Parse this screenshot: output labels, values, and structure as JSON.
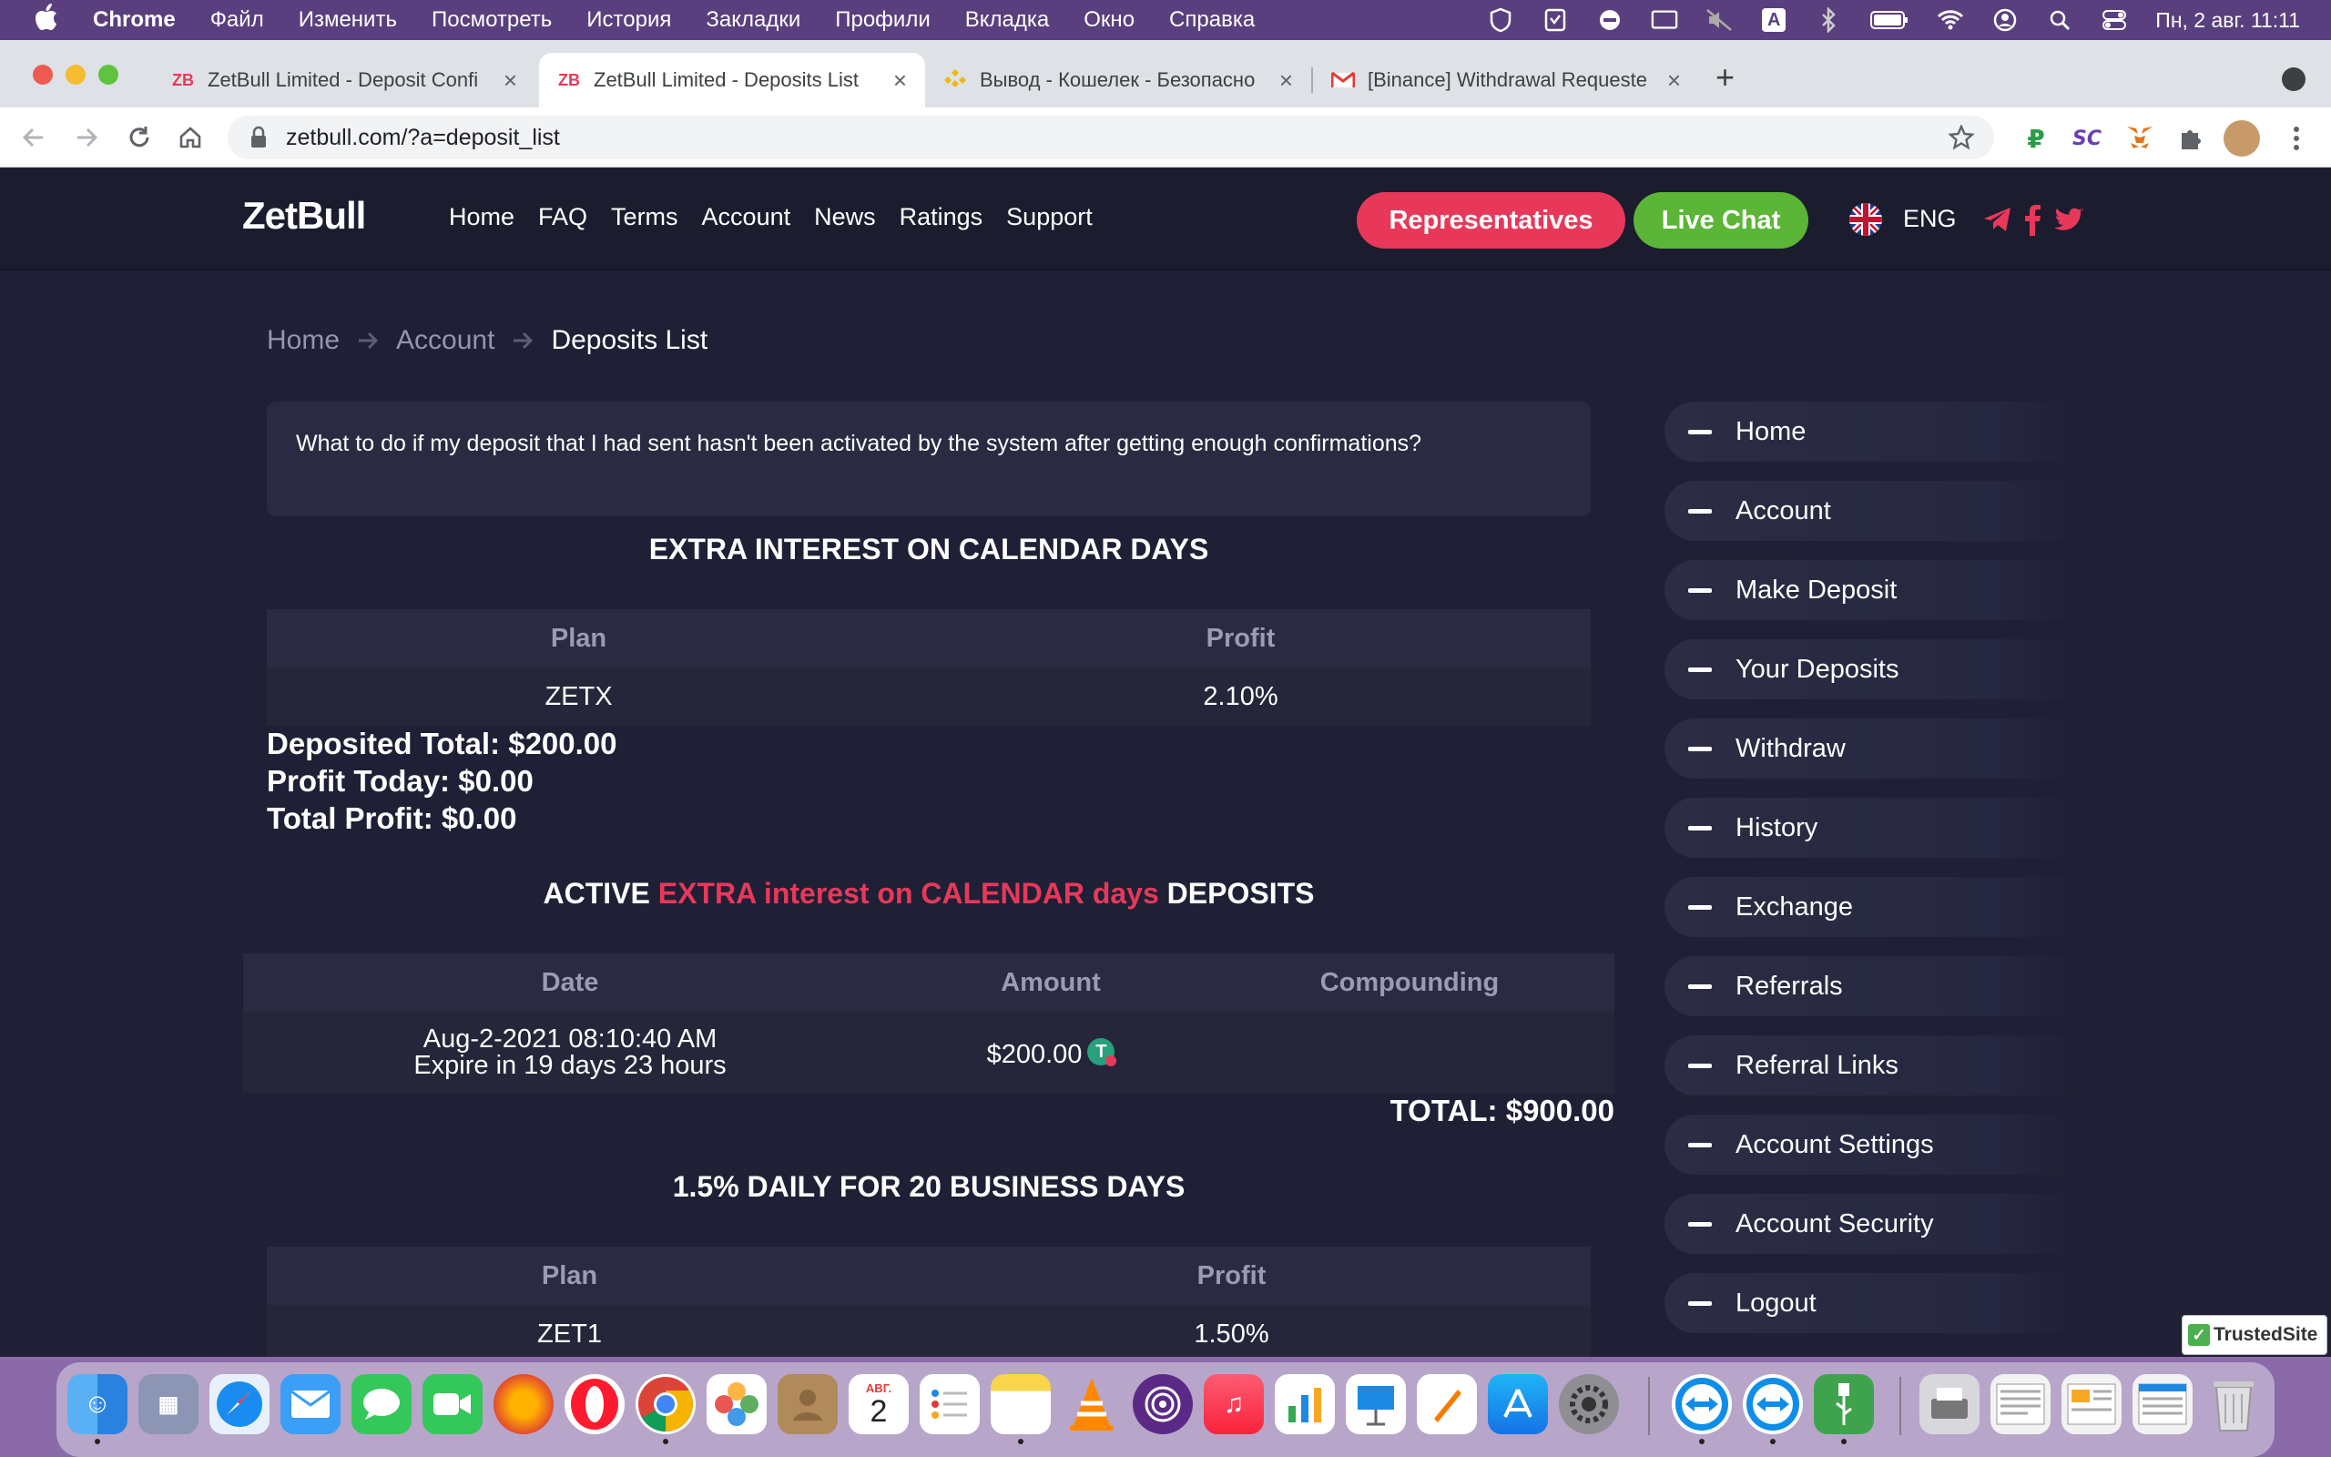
{
  "menubar": {
    "app": "Chrome",
    "items": [
      "Файл",
      "Изменить",
      "Посмотреть",
      "История",
      "Закладки",
      "Профили",
      "Вкладка",
      "Окно",
      "Справка"
    ],
    "clock": "Пн, 2 авг.  11:11",
    "status_icons": [
      "vpn-shield-icon",
      "shield-check-icon",
      "no-entry-icon",
      "display-icon",
      "mute-icon",
      "input-source-icon",
      "bluetooth-icon",
      "battery-icon",
      "wifi-icon",
      "user-icon",
      "spotlight-icon",
      "control-center-icon"
    ],
    "input_source": "A"
  },
  "tabs": [
    {
      "label": "ZetBull Limited - Deposit Confi",
      "favicon": "ZB",
      "active": false
    },
    {
      "label": "ZetBull Limited - Deposits List",
      "favicon": "ZB",
      "active": true
    },
    {
      "label": "Вывод - Кошелек - Безопасно",
      "favicon": "binance-icon",
      "active": false
    },
    {
      "label": "[Binance] Withdrawal Requeste",
      "favicon": "gmail-icon",
      "active": false
    }
  ],
  "address_bar": {
    "url": "zetbull.com/?a=deposit_list"
  },
  "extensions": [
    "ruble-icon",
    "sc-icon",
    "metamask-icon",
    "puzzle-icon",
    "profile-avatar",
    "menu-dots-icon"
  ],
  "site": {
    "logo": "ZetBull",
    "nav": [
      "Home",
      "FAQ",
      "Terms",
      "Account",
      "News",
      "Ratings",
      "Support"
    ],
    "representatives": "Representatives",
    "live_chat": "Live Chat",
    "language": "ENG",
    "colors": {
      "accent_red": "#e8385a",
      "accent_green": "#5bb537",
      "bg": "#1f2035"
    }
  },
  "breadcrumb": [
    "Home",
    "Account",
    "Deposits List"
  ],
  "faq_question": "What to do if my deposit that I had sent hasn't been activated by the system after getting enough confirmations?",
  "section1": {
    "title": "EXTRA INTEREST ON CALENDAR DAYS",
    "headers": {
      "plan": "Plan",
      "profit": "Profit"
    },
    "row": {
      "plan": "ZETX",
      "profit": "2.10%"
    },
    "deposited_total": "Deposited Total: $200.00",
    "profit_today": "Profit Today: $0.00",
    "total_profit": "Total Profit: $0.00"
  },
  "active": {
    "prefix": "ACTIVE",
    "highlight": "EXTRA interest on CALENDAR days",
    "suffix": "DEPOSITS",
    "headers": {
      "date": "Date",
      "amount": "Amount",
      "compounding": "Compounding"
    },
    "row": {
      "date": "Aug-2-2021 08:10:40 AM",
      "expire": "Expire in 19 days 23 hours",
      "amount": "$200.00",
      "compounding": ""
    },
    "total": "TOTAL: $900.00"
  },
  "section2": {
    "title": "1.5% DAILY FOR 20 BUSINESS DAYS",
    "headers": {
      "plan": "Plan",
      "profit": "Profit"
    },
    "row": {
      "plan": "ZET1",
      "profit": "1.50%"
    }
  },
  "sidebar": [
    "Home",
    "Account",
    "Make Deposit",
    "Your Deposits",
    "Withdraw",
    "History",
    "Exchange",
    "Referrals",
    "Referral Links",
    "Account Settings",
    "Account Security",
    "Logout"
  ],
  "trusted_badge": "TrustedSite",
  "dock": {
    "calendar_month": "АВГ.",
    "calendar_day": "2",
    "apps": [
      "finder-icon",
      "launchpad-icon",
      "safari-icon",
      "mail-icon",
      "messages-icon",
      "facetime-icon",
      "firefox-icon",
      "opera-icon",
      "chrome-icon",
      "photos-icon",
      "contacts-icon",
      "calendar-icon",
      "reminders-icon",
      "notes-icon",
      "vlc-icon",
      "tor-icon",
      "music-icon",
      "numbers-icon",
      "keynote-icon",
      "pages-icon",
      "app-store-icon",
      "system-preferences-icon",
      "teamviewer-icon",
      "teamviewer-qs-icon",
      "usb-utility-icon"
    ]
  }
}
